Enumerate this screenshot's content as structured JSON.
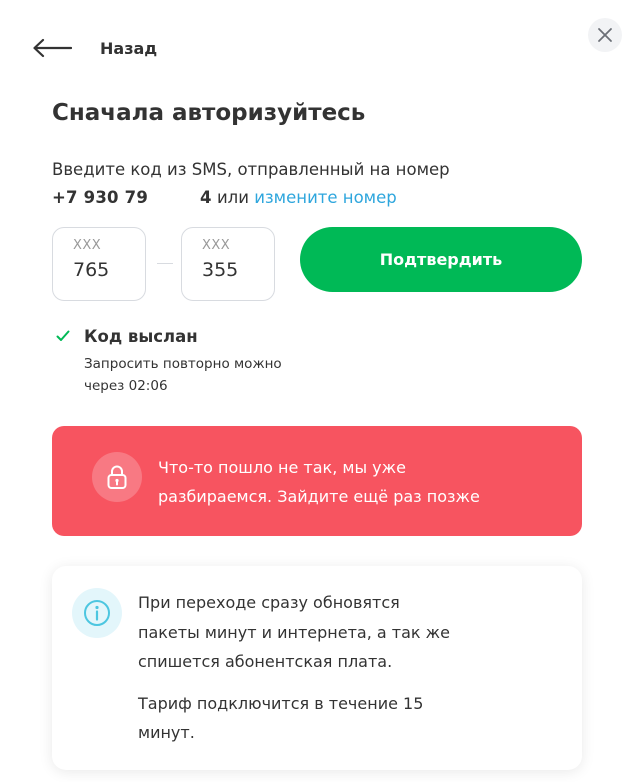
{
  "header": {
    "back_label": "Назад",
    "back_icon": "arrow-left-icon",
    "close_icon": "close-icon"
  },
  "auth": {
    "title": "Сначала авторизуйтесь",
    "prompt": "Введите код из SMS, отправленный на номер",
    "phone_start": "+7 930 79",
    "phone_end": "4",
    "or_text": "или",
    "change_link": "измените номер"
  },
  "code": {
    "part1_placeholder": "XXX",
    "part1_value": "765",
    "part2_placeholder": "XXX",
    "part2_value": "355"
  },
  "confirm_button": "Подтвердить",
  "status": {
    "sent_label": "Код выслан",
    "resend_line1": "Запросить повторно можно",
    "resend_line2": "через 02:06"
  },
  "error": {
    "line1": "Что-то пошло не так, мы уже",
    "line2": "разбираемся. Зайдите ещё раз позже",
    "icon": "lock-icon"
  },
  "info": {
    "icon": "info-icon",
    "paragraph1_line1": "При переходе сразу обновятся",
    "paragraph1_line2": "пакеты минут и интернета, а так же",
    "paragraph1_line3": "спишется абонентская плата.",
    "paragraph2_line1": "Тариф подключится в течение 15",
    "paragraph2_line2": "минут."
  },
  "colors": {
    "brand_green": "#00b956",
    "error_red": "#f75460",
    "link_blue": "#2ea6dd",
    "info_accent": "#4cc6e0"
  }
}
